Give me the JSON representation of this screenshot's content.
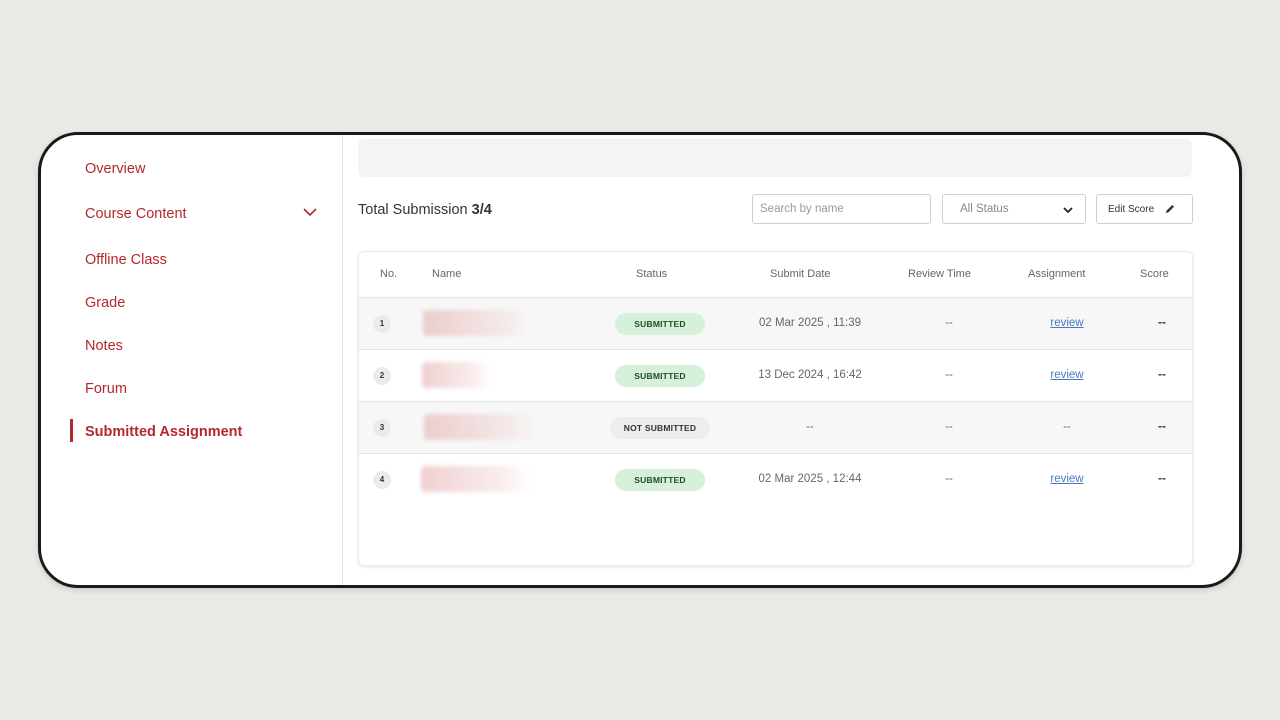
{
  "sidebar": {
    "items": [
      {
        "label": "Overview"
      },
      {
        "label": "Course Content"
      },
      {
        "label": "Offline Class"
      },
      {
        "label": "Grade"
      },
      {
        "label": "Notes"
      },
      {
        "label": "Forum"
      },
      {
        "label": "Submitted Assignment",
        "active": true
      }
    ]
  },
  "header": {
    "total_label": "Total Submission",
    "total_value": "3/4",
    "search_placeholder": "Search by name",
    "status_filter": "All Status",
    "edit_score_label": "Edit Score"
  },
  "table": {
    "columns": [
      "No.",
      "Name",
      "Status",
      "Submit Date",
      "Review Time",
      "Assignment",
      "Score"
    ],
    "rows": [
      {
        "no": "1",
        "name": "",
        "status": "SUBMITTED",
        "submit_date": "02 Mar 2025 , 11:39",
        "review_time": "--",
        "assignment": "review",
        "score": "--"
      },
      {
        "no": "2",
        "name": "",
        "status": "SUBMITTED",
        "submit_date": "13 Dec 2024 , 16:42",
        "review_time": "--",
        "assignment": "review",
        "score": "--"
      },
      {
        "no": "3",
        "name": "",
        "status": "NOT SUBMITTED",
        "submit_date": "--",
        "review_time": "--",
        "assignment": "--",
        "score": "--"
      },
      {
        "no": "4",
        "name": "",
        "status": "SUBMITTED",
        "submit_date": "02 Mar 2025 , 12:44",
        "review_time": "--",
        "assignment": "review",
        "score": "--"
      }
    ]
  },
  "colors": {
    "accent": "#b5282d",
    "submitted_badge_bg": "#d6f0d9",
    "not_submitted_badge_bg": "#ededed",
    "link": "#4a78c2"
  }
}
